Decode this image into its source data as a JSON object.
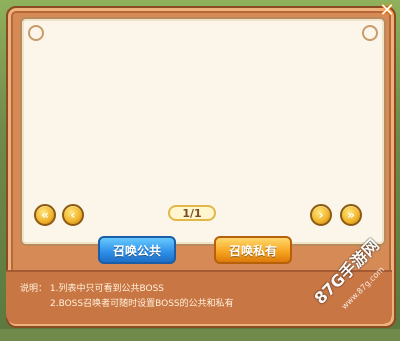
{
  "pager": {
    "first_icon": "double-chevron-left",
    "prev_icon": "chevron-left",
    "next_icon": "chevron-right",
    "last_icon": "double-chevron-right",
    "page_text": "1/1"
  },
  "actions": {
    "public_label": "召唤公共",
    "private_label": "召唤私有"
  },
  "notes": {
    "prefix": "说明：",
    "line1": "1.列表中只可看到公共BOSS",
    "line2": "2.BOSS召唤者可随时设置BOSS的公共和私有"
  },
  "watermark": {
    "brand": "87G手游网",
    "url": "www.87g.com"
  },
  "colors": {
    "frame": "#d68b57",
    "panel": "#fbf6e9",
    "public_button": "#2d8ee8",
    "private_button": "#f6a21d"
  }
}
